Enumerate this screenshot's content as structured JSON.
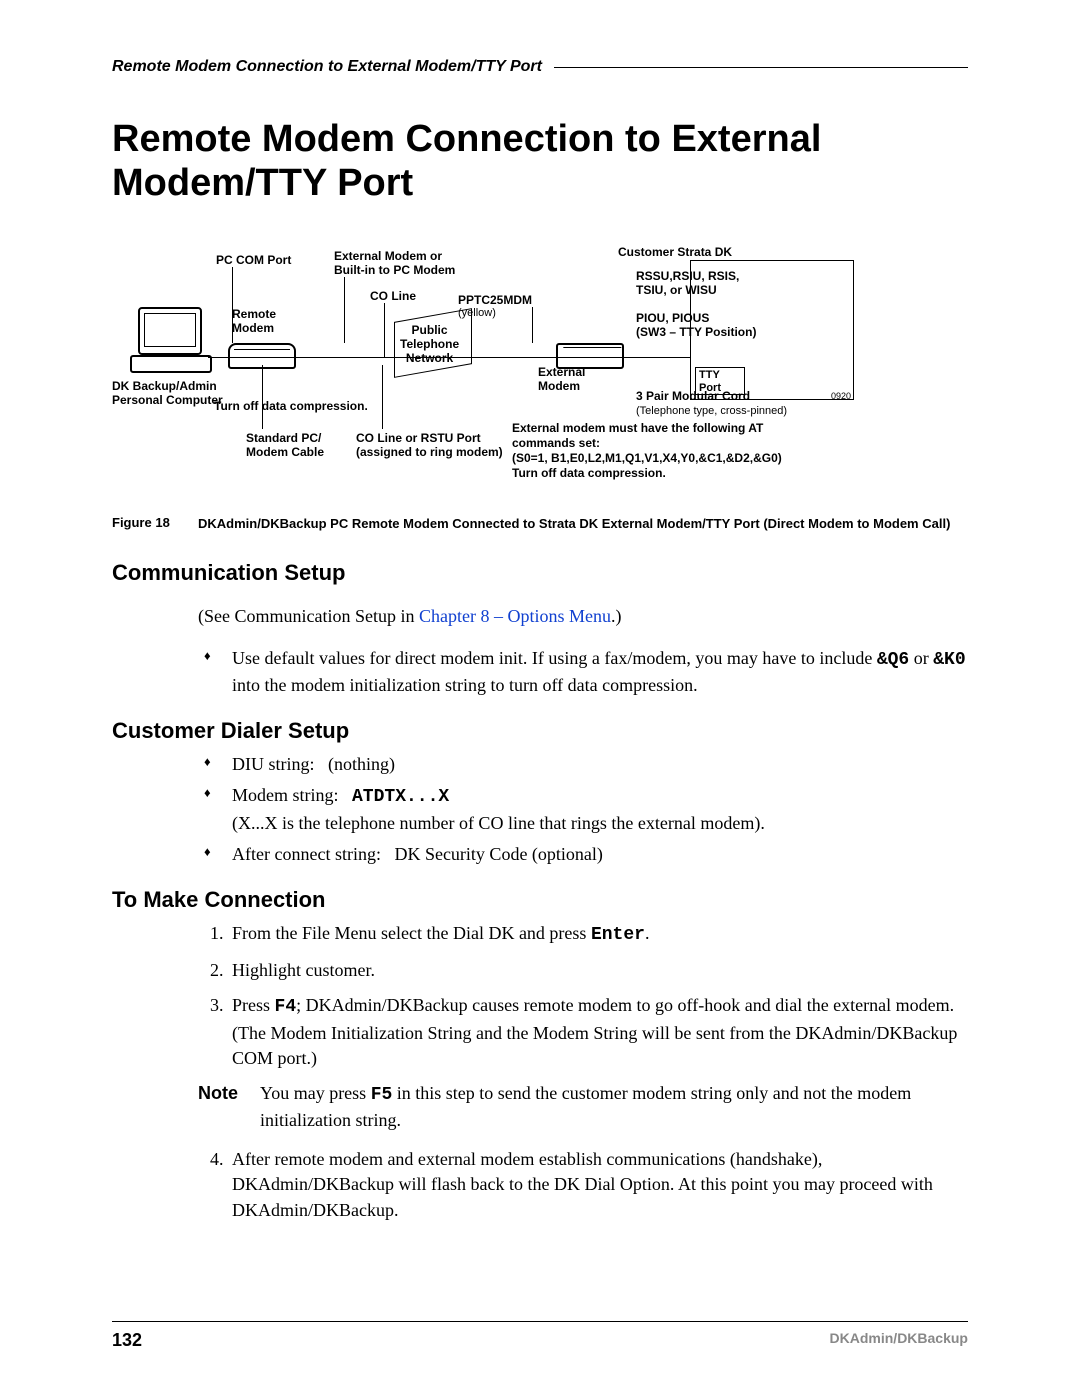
{
  "header": {
    "running": "Remote Modem Connection to External Modem/TTY Port"
  },
  "title": "Remote Modem Connection to External Modem/TTY Port",
  "figure": {
    "ref_small": "0920",
    "labels": {
      "pc_com_port": "PC COM Port",
      "external_or_builtin": "External Modem or\nBuilt-in to PC Modem",
      "co_line": "CO Line",
      "remote_modem": "Remote\nModem",
      "public_tel_net": "Public\nTelephone\nNetwork",
      "pptc25mdm": "PPTC25MDM",
      "yellow": "(yellow)",
      "external_modem": "External\nModem",
      "customer_strata": "Customer Strata DK",
      "unit_list": "RSSU,RSIU, RSIS,\nTSIU, or WISU",
      "piou": "PIOU, PIOUS\n(SW3 – TTY Position)",
      "tty_port": "TTY\nPort",
      "three_pair": "3 Pair Modular Cord",
      "tel_type": "(Telephone type, cross-pinned)",
      "dk_backup": "DK Backup/Admin\nPersonal Computer",
      "turn_off": "Turn off data compression.",
      "std_cable": "Standard PC/\nModem Cable",
      "co_or_rstu": "CO Line or RSTU Port\n(assigned to ring modem)",
      "ext_at_cmds": "External modem must have the following AT\ncommands set:\n(S0=1, B1,E0,L2,M1,Q1,V1,X4,Y0,&C1,&D2,&G0)\nTurn off data compression."
    },
    "caption_label": "Figure 18",
    "caption_text": "DKAdmin/DKBackup PC Remote Modem Connected to Strata DK External Modem/TTY Port (Direct Modem to Modem Call)"
  },
  "sections": {
    "s1": {
      "heading": "Communication Setup",
      "intro_pre": "(See Communication Setup in ",
      "intro_link": "Chapter 8 – Options Menu",
      "intro_post": ".)",
      "bullet1_pre": "Use default values for direct modem init. If using a fax/modem, you may have to include ",
      "bullet1_code1": "&Q6",
      "bullet1_mid": " or ",
      "bullet1_code2": "&K0",
      "bullet1_post": " into the modem initialization string to turn off data compression."
    },
    "s2": {
      "heading": "Customer Dialer Setup",
      "b1": "DIU string:   (nothing)",
      "b2_pre": "Modem string:   ",
      "b2_code": "ATDTX...X",
      "b2_note": "(X...X is the telephone number of CO line that rings the external modem).",
      "b3": "After connect string:   DK Security Code (optional)"
    },
    "s3": {
      "heading": "To Make Connection",
      "step1_pre": "From the File Menu select the Dial DK and press ",
      "step1_code": "Enter",
      "step1_post": ".",
      "step2": "Highlight customer.",
      "step3_pre": "Press ",
      "step3_code": "F4",
      "step3_post": "; DKAdmin/DKBackup causes remote modem to go off-hook and dial the external modem. (The Modem Initialization String and the Modem String will be sent from the DKAdmin/DKBackup COM port.)",
      "note_label": "Note",
      "note_pre": "You may press ",
      "note_code": "F5",
      "note_post": " in this step to send the customer modem string only and not the modem initialization string.",
      "step4": "After remote modem and external modem establish communications (handshake), DKAdmin/DKBackup will flash back to the DK Dial Option. At this point you may proceed with DKAdmin/DKBackup."
    }
  },
  "footer": {
    "page": "132",
    "product": "DKAdmin/DKBackup"
  }
}
